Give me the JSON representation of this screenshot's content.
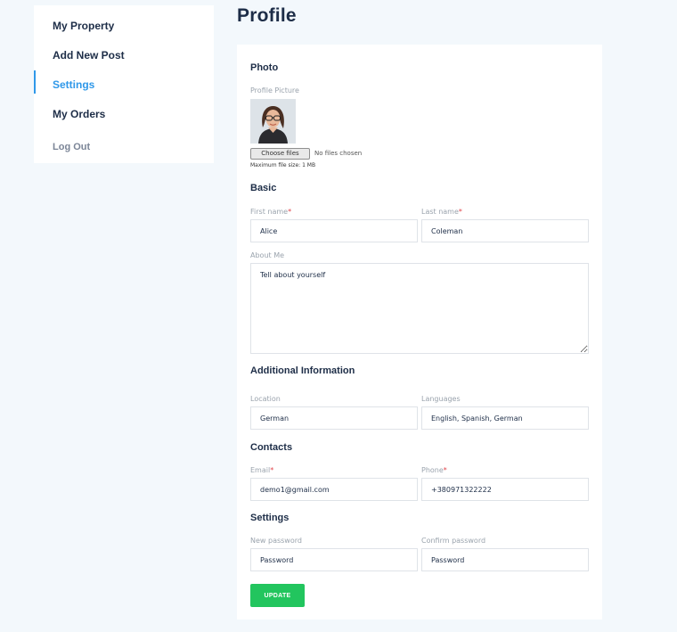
{
  "sidebar": {
    "items": [
      {
        "label": "My Property"
      },
      {
        "label": "Add New Post"
      },
      {
        "label": "Settings"
      },
      {
        "label": "My Orders"
      }
    ],
    "logout": "Log Out"
  },
  "page": {
    "title": "Profile"
  },
  "photo": {
    "section": "Photo",
    "label": "Profile Picture",
    "choose_button": "Choose files",
    "status": "No files chosen",
    "note": "Maximum file size: 1 MB"
  },
  "basic": {
    "section": "Basic",
    "first_name_label": "First name",
    "first_name_value": "Alice",
    "last_name_label": "Last name",
    "last_name_value": "Coleman",
    "about_label": "About Me",
    "about_placeholder": "Tell about yourself"
  },
  "additional": {
    "section": "Additional Information",
    "location_label": "Location",
    "location_value": "German",
    "languages_label": "Languages",
    "languages_value": "English, Spanish, German"
  },
  "contacts": {
    "section": "Contacts",
    "email_label": "Email",
    "email_value": "demo1@gmail.com",
    "phone_label": "Phone",
    "phone_value": "+380971322222"
  },
  "settings": {
    "section": "Settings",
    "new_password_label": "New password",
    "new_password_placeholder": "Password",
    "confirm_password_label": "Confirm password",
    "confirm_password_placeholder": "Password"
  },
  "actions": {
    "update": "UPDATE"
  },
  "required_mark": "*"
}
